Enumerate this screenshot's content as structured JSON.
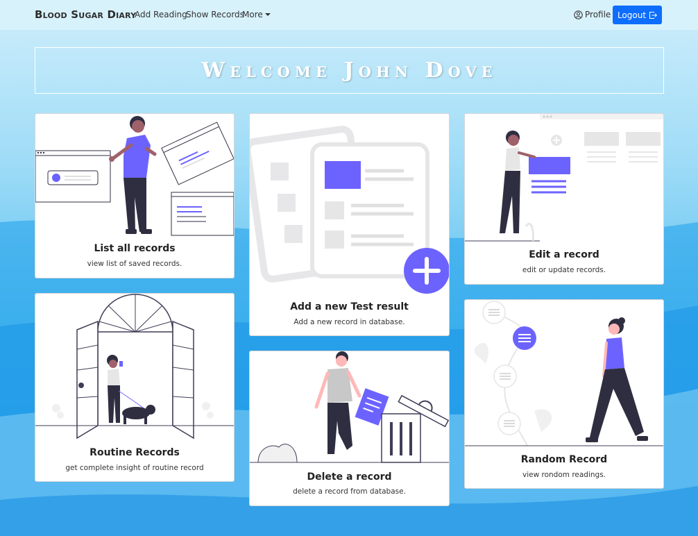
{
  "navbar": {
    "brand": "Blood Sugar Diary",
    "links": [
      "Add Reading",
      "Show Records",
      "More"
    ],
    "profile_label": "Profile",
    "logout_label": "Logout"
  },
  "welcome": {
    "text": "Welcome John Dove"
  },
  "cards": [
    {
      "title": "List all records",
      "text": "view list of saved records."
    },
    {
      "title": "Add a new Test result",
      "text": "Add a new record in database."
    },
    {
      "title": "Edit a record",
      "text": "edit or update records."
    },
    {
      "title": "Routine Records",
      "text": "get complete insight of routine record"
    },
    {
      "title": "Delete a record",
      "text": "delete a record from database."
    },
    {
      "title": "Random Record",
      "text": "view rondom readings."
    }
  ],
  "colors": {
    "accent": "#6c63ff",
    "button": "#0d6efd",
    "dark": "#2f2e41"
  }
}
